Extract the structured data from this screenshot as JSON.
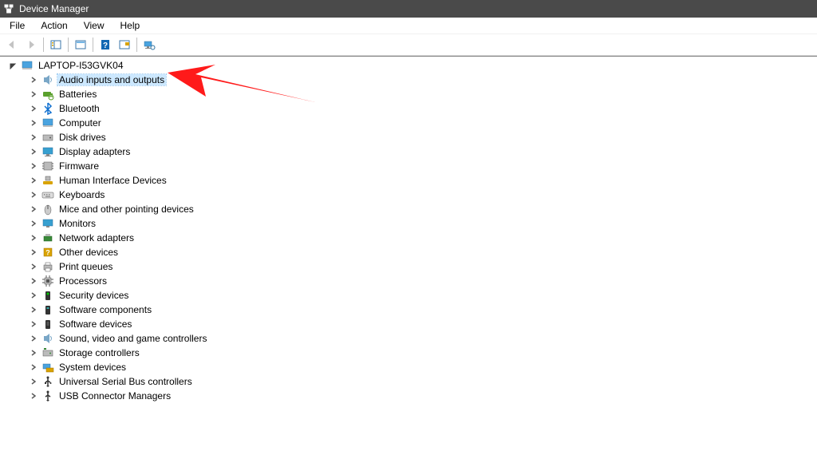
{
  "window": {
    "title": "Device Manager"
  },
  "menu": {
    "file": "File",
    "action": "Action",
    "view": "View",
    "help": "Help"
  },
  "tree": {
    "root": "LAPTOP-I53GVK04",
    "items": [
      {
        "icon": "speaker",
        "label": "Audio inputs and outputs",
        "selected": true
      },
      {
        "icon": "battery",
        "label": "Batteries"
      },
      {
        "icon": "bluetooth",
        "label": "Bluetooth"
      },
      {
        "icon": "computer",
        "label": "Computer"
      },
      {
        "icon": "disk",
        "label": "Disk drives"
      },
      {
        "icon": "display",
        "label": "Display adapters"
      },
      {
        "icon": "firmware",
        "label": "Firmware"
      },
      {
        "icon": "hid",
        "label": "Human Interface Devices"
      },
      {
        "icon": "keyboard",
        "label": "Keyboards"
      },
      {
        "icon": "mouse",
        "label": "Mice and other pointing devices"
      },
      {
        "icon": "monitor",
        "label": "Monitors"
      },
      {
        "icon": "network",
        "label": "Network adapters"
      },
      {
        "icon": "other",
        "label": "Other devices"
      },
      {
        "icon": "printer",
        "label": "Print queues"
      },
      {
        "icon": "cpu",
        "label": "Processors"
      },
      {
        "icon": "security",
        "label": "Security devices"
      },
      {
        "icon": "swcomp",
        "label": "Software components"
      },
      {
        "icon": "swdev",
        "label": "Software devices"
      },
      {
        "icon": "sound",
        "label": "Sound, video and game controllers"
      },
      {
        "icon": "storage",
        "label": "Storage controllers"
      },
      {
        "icon": "system",
        "label": "System devices"
      },
      {
        "icon": "usb",
        "label": "Universal Serial Bus controllers"
      },
      {
        "icon": "usbconn",
        "label": "USB Connector Managers"
      }
    ]
  }
}
